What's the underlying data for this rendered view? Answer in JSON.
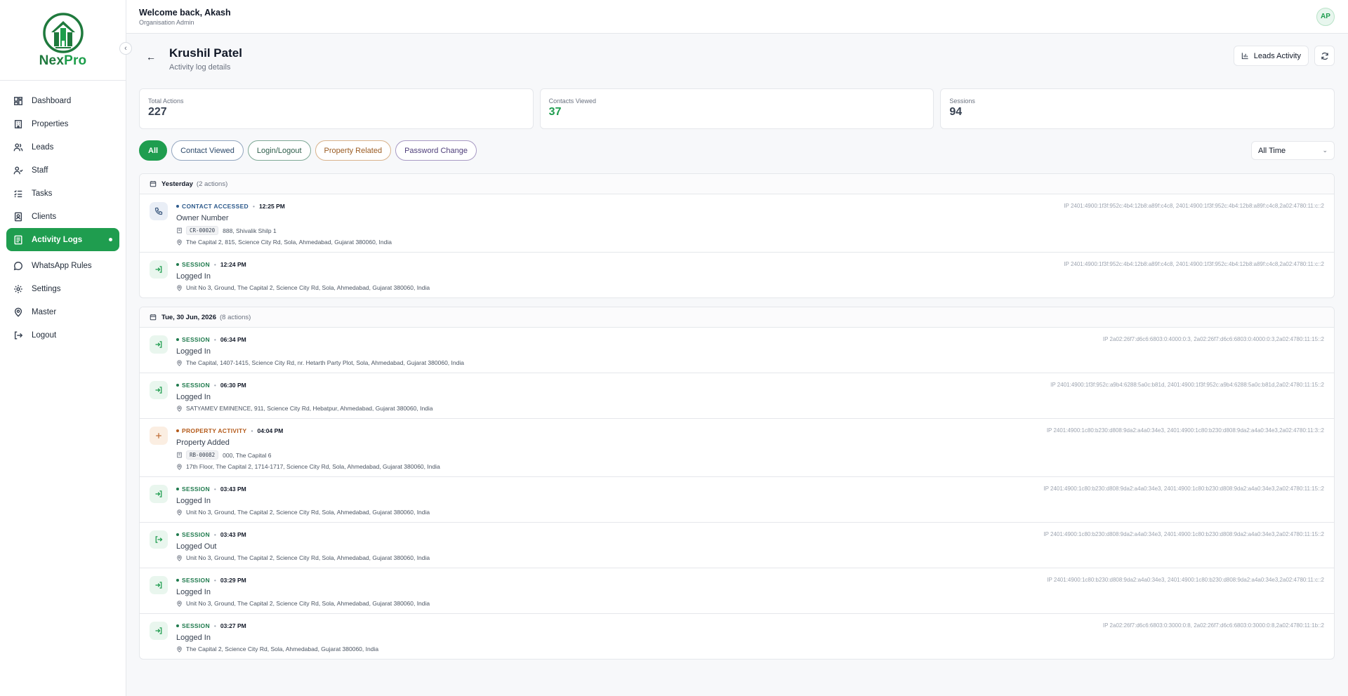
{
  "brand": {
    "name_left": "Nex",
    "name_right": "Pro"
  },
  "sidebar": {
    "items": [
      {
        "label": "Dashboard",
        "icon": "dashboard-icon"
      },
      {
        "label": "Properties",
        "icon": "building-icon"
      },
      {
        "label": "Leads",
        "icon": "users-icon"
      },
      {
        "label": "Staff",
        "icon": "user-check-icon"
      },
      {
        "label": "Tasks",
        "icon": "list-icon"
      },
      {
        "label": "Clients",
        "icon": "contact-book-icon"
      },
      {
        "label": "Activity Logs",
        "icon": "log-icon",
        "active": true
      },
      {
        "label": "WhatsApp Rules",
        "icon": "chat-icon"
      },
      {
        "label": "Settings",
        "icon": "gear-icon"
      },
      {
        "label": "Master",
        "icon": "map-pin-icon"
      },
      {
        "label": "Logout",
        "icon": "logout-icon"
      }
    ]
  },
  "topbar": {
    "welcome": "Welcome back, Akash",
    "role": "Organisation Admin",
    "avatar": "AP"
  },
  "page": {
    "title": "Krushil Patel",
    "subtitle": "Activity log details",
    "leads_button": "Leads Activity"
  },
  "stats": [
    {
      "label": "Total Actions",
      "value": "227"
    },
    {
      "label": "Contacts Viewed",
      "value": "37"
    },
    {
      "label": "Sessions",
      "value": "94"
    }
  ],
  "filters": {
    "chips": [
      "All",
      "Contact Viewed",
      "Login/Logout",
      "Property Related",
      "Password Change"
    ],
    "range": "All Time"
  },
  "groups": [
    {
      "date": "Yesterday",
      "count": "(2 actions)",
      "rows": [
        {
          "kind": "contact",
          "type": "CONTACT ACCESSED",
          "time": "12:25 PM",
          "title": "Owner Number",
          "code": "CR-00020",
          "detail": "888, Shivalik Shilp 1",
          "location": "The Capital 2, 815, Science City Rd, Sola, Ahmedabad, Gujarat 380060, India",
          "ip": "IP 2401:4900:1f3f:952c:4b4:12b8:a89f:c4c8, 2401:4900:1f3f:952c:4b4:12b8:a89f:c4c8,2a02:4780:11:c::2"
        },
        {
          "kind": "login",
          "type": "SESSION",
          "time": "12:24 PM",
          "title": "Logged In",
          "location": "Unit No 3, Ground, The Capital 2, Science City Rd, Sola, Ahmedabad, Gujarat 380060, India",
          "ip": "IP 2401:4900:1f3f:952c:4b4:12b8:a89f:c4c8, 2401:4900:1f3f:952c:4b4:12b8:a89f:c4c8,2a02:4780:11:c::2"
        }
      ]
    },
    {
      "date": "Tue, 30 Jun, 2026",
      "count": "(8 actions)",
      "rows": [
        {
          "kind": "login",
          "type": "SESSION",
          "time": "06:34 PM",
          "title": "Logged In",
          "location": "The Capital, 1407-1415, Science City Rd, nr. Hetarth Party Plot, Sola, Ahmedabad, Gujarat 380060, India",
          "ip": "IP 2a02:26f7:d6c6:6803:0:4000:0:3, 2a02:26f7:d6c6:6803:0:4000:0:3,2a02:4780:11:15::2"
        },
        {
          "kind": "login",
          "type": "SESSION",
          "time": "06:30 PM",
          "title": "Logged In",
          "location": "SATYAMEV EMINENCE, 911, Science City Rd, Hebatpur, Ahmedabad, Gujarat 380060, India",
          "ip": "IP 2401:4900:1f3f:952c:a9b4:6288:5a0c:b81d, 2401:4900:1f3f:952c:a9b4:6288:5a0c:b81d,2a02:4780:11:15::2"
        },
        {
          "kind": "prop",
          "type": "PROPERTY ACTIVITY",
          "time": "04:04 PM",
          "title": "Property Added",
          "code": "RB-00082",
          "detail": "000, The Capital 6",
          "location": "17th Floor, The Capital 2, 1714-1717, Science City Rd, Sola, Ahmedabad, Gujarat 380060, India",
          "ip": "IP 2401:4900:1c80:b230:d808:9da2:a4a0:34e3, 2401:4900:1c80:b230:d808:9da2:a4a0:34e3,2a02:4780:11:3::2"
        },
        {
          "kind": "login",
          "type": "SESSION",
          "time": "03:43 PM",
          "title": "Logged In",
          "location": "Unit No 3, Ground, The Capital 2, Science City Rd, Sola, Ahmedabad, Gujarat 380060, India",
          "ip": "IP 2401:4900:1c80:b230:d808:9da2:a4a0:34e3, 2401:4900:1c80:b230:d808:9da2:a4a0:34e3,2a02:4780:11:15::2"
        },
        {
          "kind": "logout",
          "type": "SESSION",
          "time": "03:43 PM",
          "title": "Logged Out",
          "location": "Unit No 3, Ground, The Capital 2, Science City Rd, Sola, Ahmedabad, Gujarat 380060, India",
          "ip": "IP 2401:4900:1c80:b230:d808:9da2:a4a0:34e3, 2401:4900:1c80:b230:d808:9da2:a4a0:34e3,2a02:4780:11:15::2"
        },
        {
          "kind": "login",
          "type": "SESSION",
          "time": "03:29 PM",
          "title": "Logged In",
          "location": "Unit No 3, Ground, The Capital 2, Science City Rd, Sola, Ahmedabad, Gujarat 380060, India",
          "ip": "IP 2401:4900:1c80:b230:d808:9da2:a4a0:34e3, 2401:4900:1c80:b230:d808:9da2:a4a0:34e3,2a02:4780:11:c::2"
        },
        {
          "kind": "login",
          "type": "SESSION",
          "time": "03:27 PM",
          "title": "Logged In",
          "location": "The Capital 2, Science City Rd, Sola, Ahmedabad, Gujarat 380060, India",
          "ip": "IP 2a02:26f7:d6c6:6803:0:3000:0:8, 2a02:26f7:d6c6:6803:0:3000:0:8,2a02:4780:11:1b::2"
        }
      ]
    }
  ],
  "colors": {
    "accent": "#1f9d4f",
    "contact": "#2d5a8c",
    "property": "#b45a1a"
  }
}
